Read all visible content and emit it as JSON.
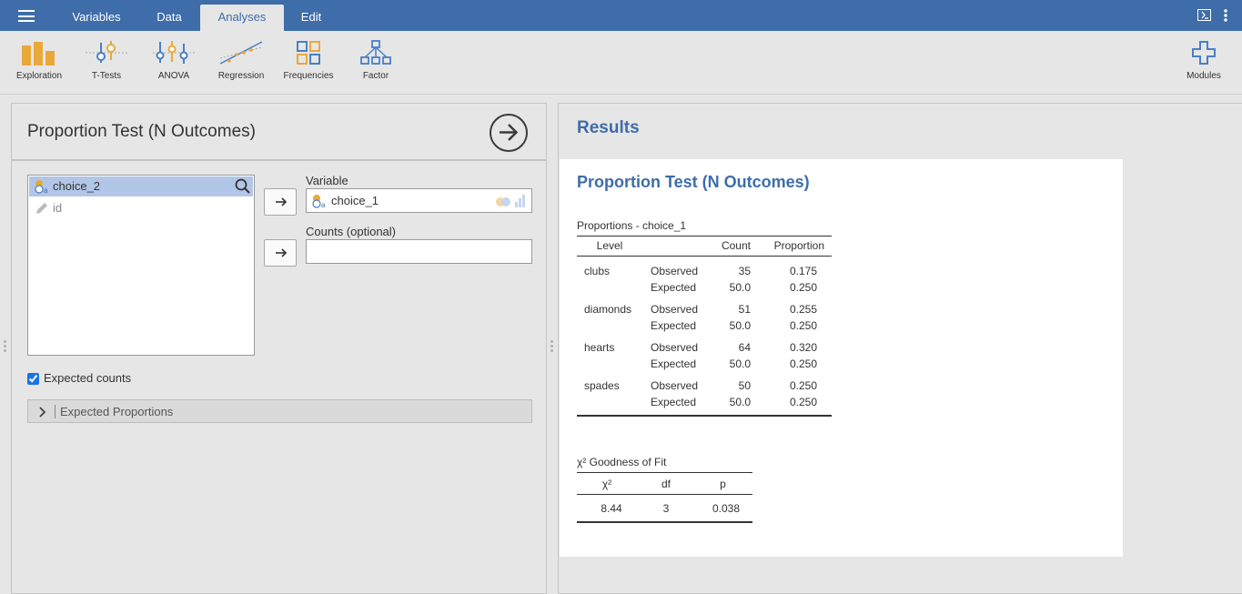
{
  "topbar": {
    "tabs": [
      "Variables",
      "Data",
      "Analyses",
      "Edit"
    ],
    "active_tab": "Analyses",
    "colors": {
      "bar": "#3e6da9",
      "panel": "#e6e6e6"
    }
  },
  "ribbon": {
    "items": [
      "Exploration",
      "T-Tests",
      "ANOVA",
      "Regression",
      "Frequencies",
      "Factor"
    ],
    "modules_label": "Modules"
  },
  "options": {
    "title": "Proportion Test (N Outcomes)",
    "available_vars": [
      {
        "name": "choice_2",
        "icon": "nominal-text-icon",
        "selected": true
      },
      {
        "name": "id",
        "icon": "id-pencil-icon",
        "selected": false
      }
    ],
    "variable_label": "Variable",
    "variable_value": "choice_1",
    "counts_label": "Counts (optional)",
    "counts_value": "",
    "expected_counts_label": "Expected counts",
    "expected_counts_checked": true,
    "expected_proportions_label": "Expected Proportions"
  },
  "results": {
    "heading": "Results",
    "title": "Proportion Test (N Outcomes)",
    "proportions_table": {
      "title": "Proportions - choice_1",
      "columns": [
        "Level",
        "",
        "Count",
        "Proportion"
      ],
      "groups": [
        {
          "level": "clubs",
          "rows": [
            [
              "Observed",
              "35",
              "0.175"
            ],
            [
              "Expected",
              "50.0",
              "0.250"
            ]
          ]
        },
        {
          "level": "diamonds",
          "rows": [
            [
              "Observed",
              "51",
              "0.255"
            ],
            [
              "Expected",
              "50.0",
              "0.250"
            ]
          ]
        },
        {
          "level": "hearts",
          "rows": [
            [
              "Observed",
              "64",
              "0.320"
            ],
            [
              "Expected",
              "50.0",
              "0.250"
            ]
          ]
        },
        {
          "level": "spades",
          "rows": [
            [
              "Observed",
              "50",
              "0.250"
            ],
            [
              "Expected",
              "50.0",
              "0.250"
            ]
          ]
        }
      ]
    },
    "gof_table": {
      "title": "χ² Goodness of Fit",
      "columns": [
        "χ²",
        "df",
        "p"
      ],
      "row": [
        "8.44",
        "3",
        "0.038"
      ]
    }
  }
}
